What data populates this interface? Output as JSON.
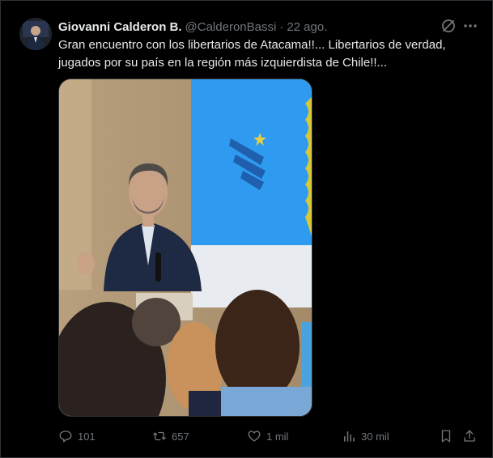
{
  "tweet": {
    "author_name": "Giovanni Calderon B.",
    "author_handle": "@CalderonBassi",
    "separator": "·",
    "date": "22 ago.",
    "text_line1": "Gran encuentro con los libertarios de Atacama!!... Libertarios de verdad,",
    "text_line2": "jugados por su país en la región más izquierdista de Chile!!...",
    "media_alt": "Man speaking at a podium with a microphone in front of a blue screen with a logo; audience in the foreground"
  },
  "actions": {
    "replies": "101",
    "reposts": "657",
    "likes": "1 mil",
    "views": "30 mil"
  },
  "icons": {
    "grok": "grok-icon",
    "more": "more-icon",
    "reply": "reply-icon",
    "repost": "repost-icon",
    "like": "heart-icon",
    "views": "analytics-icon",
    "bookmark": "bookmark-icon",
    "share": "share-icon"
  },
  "colors": {
    "background": "#000000",
    "text": "#e7e9ea",
    "muted": "#71767b",
    "border": "#2f3336",
    "screen_blue": "#2f9bf0"
  }
}
